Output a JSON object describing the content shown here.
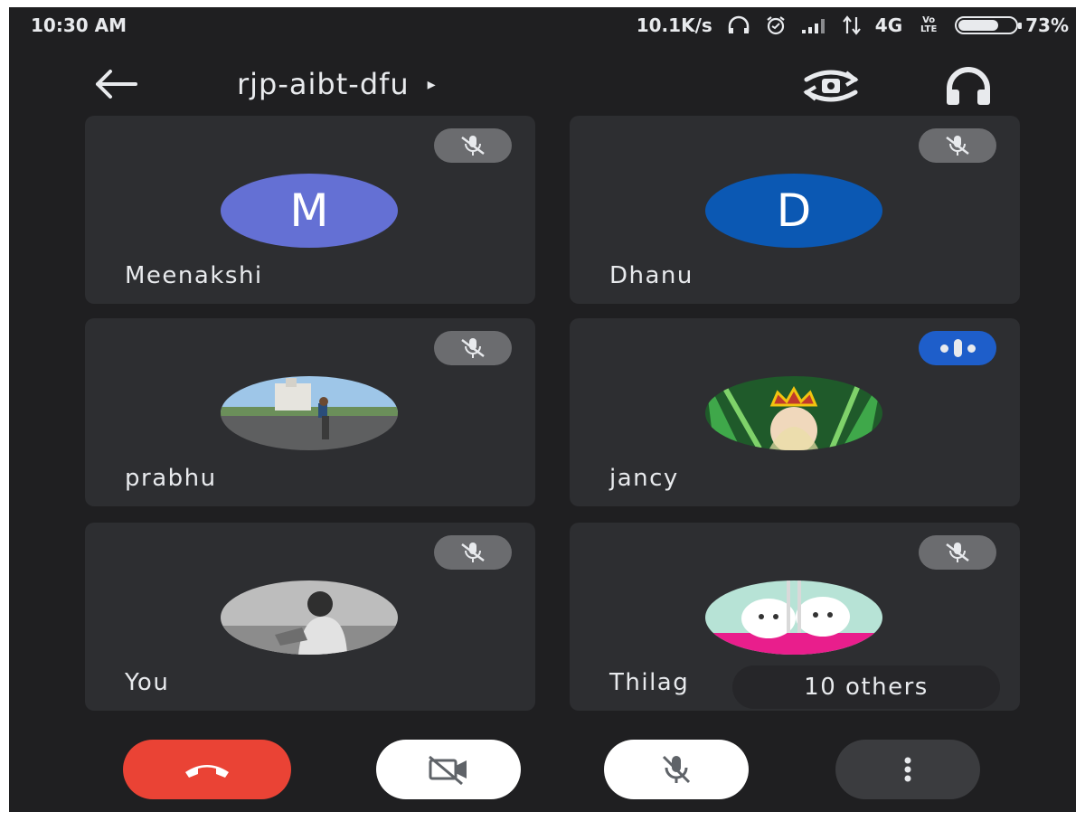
{
  "status_bar": {
    "time": "10:30 AM",
    "network_speed": "10.1K/s",
    "network_type": "4G",
    "volte": "Vo LTE",
    "battery_percent": "73%",
    "battery_level": 0.73
  },
  "header": {
    "meeting_code": "rjp-aibt-dfu",
    "title_arrow": "▸"
  },
  "participants": [
    {
      "name": "Meenakshi",
      "initial": "M",
      "avatar_color": "#6470d4",
      "muted": true,
      "speaking": false
    },
    {
      "name": "Dhanu",
      "initial": "D",
      "avatar_color": "#0b58b3",
      "muted": true,
      "speaking": false
    },
    {
      "name": "prabhu",
      "initial": "",
      "muted": true,
      "speaking": false
    },
    {
      "name": "jancy",
      "initial": "",
      "muted": false,
      "speaking": true
    },
    {
      "name": "You",
      "initial": "",
      "muted": true,
      "speaking": false
    },
    {
      "name": "Thilag",
      "initial": "",
      "muted": true,
      "speaking": false
    }
  ],
  "overflow": {
    "label": "10 others"
  },
  "controls": {
    "hangup_color": "#ea4335",
    "camera_state": "off",
    "mic_state": "muted"
  },
  "icons": {
    "back": "arrow-left-icon",
    "switch_camera": "switch-camera-icon",
    "audio": "headphones-icon",
    "muted_mic": "mic-off-icon",
    "speaking": "audio-level-icon",
    "hangup": "call-end-icon",
    "camera_off": "videocam-off-icon",
    "more": "more-vert-icon"
  }
}
